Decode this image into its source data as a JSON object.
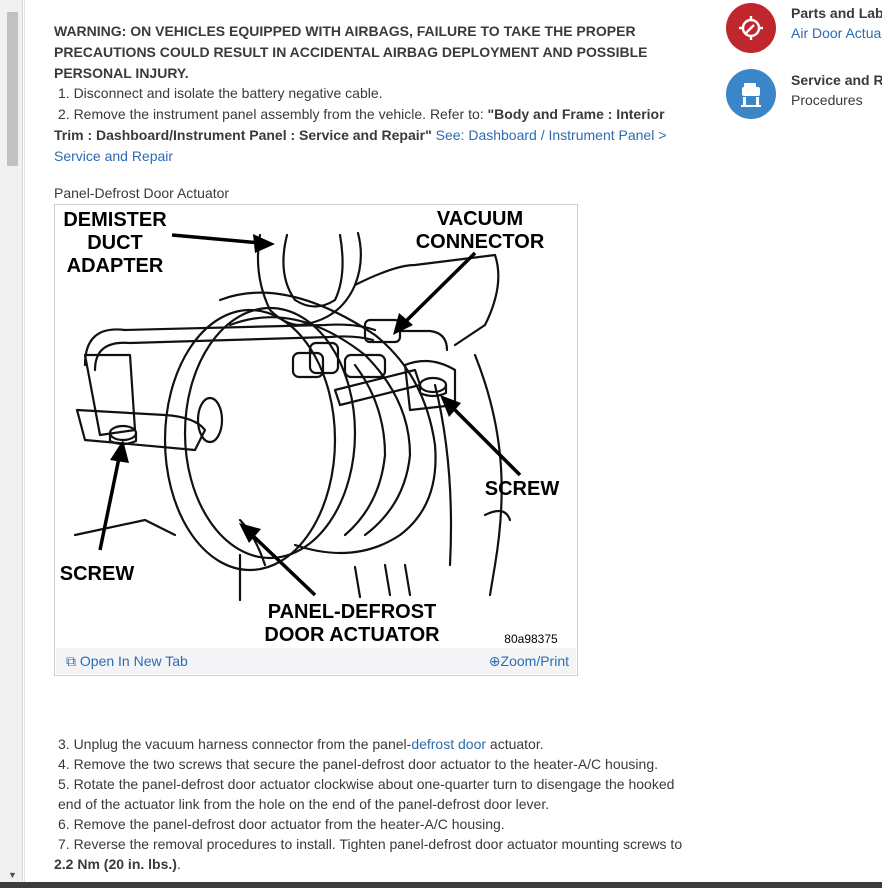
{
  "warning": "WARNING: ON VEHICLES EQUIPPED WITH AIRBAGS, FAILURE TO TAKE THE PROPER PRECAUTIONS COULD RESULT IN ACCIDENTAL AIRBAG DEPLOYMENT AND POSSIBLE PERSONAL INJURY.",
  "steps_part1": {
    "s1": "1. Disconnect and isolate the battery negative cable.",
    "s2_prefix": "2. Remove the instrument panel assembly from the vehicle. Refer to: ",
    "s2_bold": "\"Body and Frame : Interior Trim : Dashboard/Instrument Panel : Service and Repair\"",
    "s2_link": "See: Dashboard / Instrument Panel > Service and Repair"
  },
  "figure": {
    "caption": "Panel-Defrost Door Actuator",
    "labels": {
      "demister_1": "DEMISTER",
      "demister_2": "DUCT",
      "demister_3": "ADAPTER",
      "vacuum_1": "VACUUM",
      "vacuum_2": "CONNECTOR",
      "screw_right": "SCREW",
      "screw_left": "SCREW",
      "actuator_1": "PANEL-DEFROST",
      "actuator_2": "DOOR ACTUATOR",
      "figure_id": "80a98375"
    },
    "open_tab": "Open In New Tab",
    "zoom_print": "Zoom/Print"
  },
  "steps_part2": {
    "s3_prefix": "3. Unplug the vacuum harness connector from the panel-",
    "s3_link": "defrost door",
    "s3_suffix": " actuator.",
    "s4": "4. Remove the two screws that secure the panel-defrost door actuator to the heater-A/C housing.",
    "s5": "5. Rotate the panel-defrost door actuator clockwise about one-quarter turn to disengage the hooked end of the actuator link from the hole on the end of the panel-defrost door lever.",
    "s6": "6. Remove the panel-defrost door actuator from the heater-A/C housing.",
    "s7_prefix": "7. Reverse the removal procedures to install. Tighten panel-defrost door actuator mounting screws to ",
    "s7_bold": "2.2 Nm (20 in. lbs.)",
    "s7_suffix": "."
  },
  "sidebar": {
    "item1": {
      "title": "Parts and Labo",
      "sub": "Air Door Actua",
      "icon": "wrench-gear-icon",
      "color": "#c0272d"
    },
    "item2": {
      "title": "Service and Re",
      "sub": "Procedures",
      "icon": "car-lift-icon",
      "color": "#3a86c8"
    }
  }
}
